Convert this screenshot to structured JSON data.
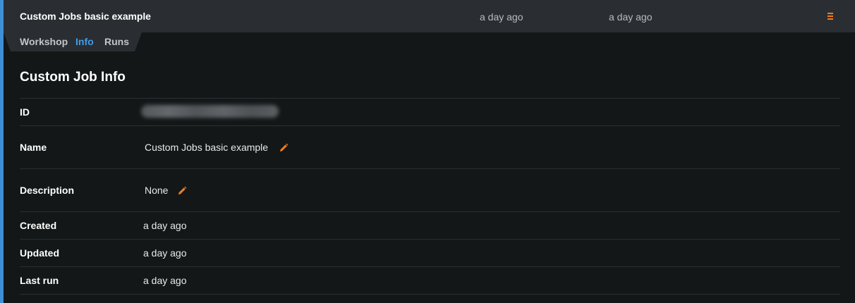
{
  "header": {
    "job_title": "Custom Jobs basic example",
    "created": "a day ago",
    "updated": "a day ago",
    "menu_icon": "hamburger-menu-icon"
  },
  "tabs": [
    {
      "label": "Workshop",
      "active": false
    },
    {
      "label": "Info",
      "active": true
    },
    {
      "label": "Runs",
      "active": false
    }
  ],
  "info": {
    "title": "Custom Job Info",
    "rows": {
      "id": {
        "label": "ID",
        "value": ""
      },
      "name": {
        "label": "Name",
        "value": "Custom Jobs basic example"
      },
      "description": {
        "label": "Description",
        "value": "None"
      },
      "created": {
        "label": "Created",
        "value": "a day ago"
      },
      "updated": {
        "label": "Updated",
        "value": "a day ago"
      },
      "last_run": {
        "label": "Last run",
        "value": "a day ago"
      }
    }
  },
  "colors": {
    "accent": "#3f8fd6",
    "active_tab": "#3f9ee8",
    "edit_icon": "#f07d1a",
    "background": "#131718",
    "topbar": "#2a2e33"
  }
}
